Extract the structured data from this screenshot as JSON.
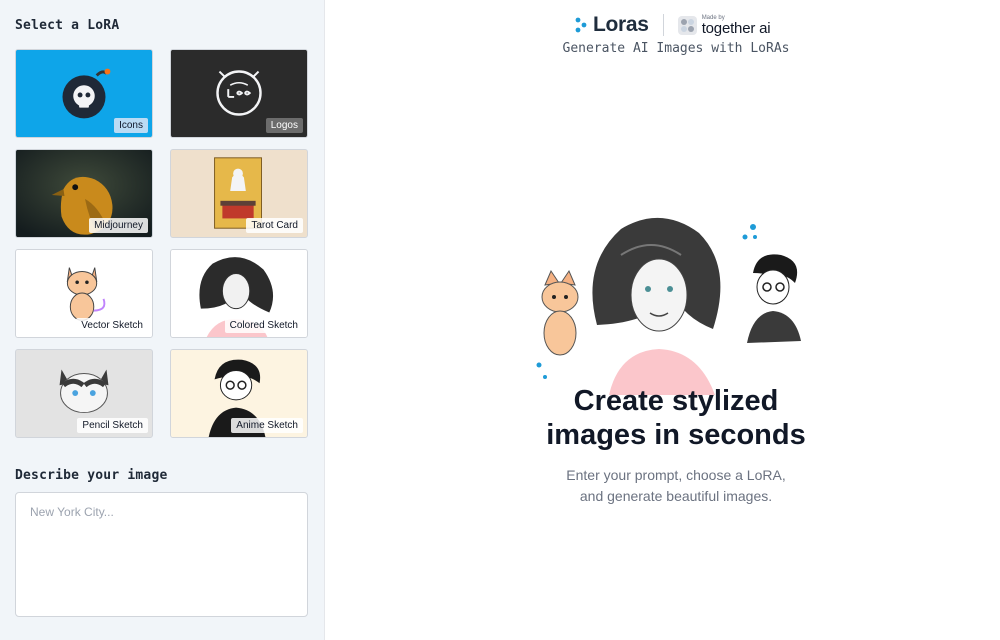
{
  "sidebar": {
    "select_title": "Select a LoRA",
    "loras": [
      {
        "label": "Icons"
      },
      {
        "label": "Logos"
      },
      {
        "label": "Midjourney"
      },
      {
        "label": "Tarot Card"
      },
      {
        "label": "Vector Sketch"
      },
      {
        "label": "Colored Sketch"
      },
      {
        "label": "Pencil Sketch"
      },
      {
        "label": "Anime Sketch"
      }
    ],
    "describe_title": "Describe your image",
    "prompt": {
      "value": "",
      "placeholder": "New York City..."
    }
  },
  "header": {
    "brand_name": "Loras",
    "partner_made_by": "Made by",
    "partner_name": "together ai",
    "tagline": "Generate AI Images with LoRAs"
  },
  "hero": {
    "title_line1": "Create stylized",
    "title_line2": "images in seconds",
    "subtitle_line1": "Enter your prompt, choose a LoRA,",
    "subtitle_line2": "and generate beautiful images."
  },
  "colors": {
    "accent": "#1e9bd7",
    "sidebar_bg": "#f1f5f9",
    "icons_tile_bg": "#0ea5e9",
    "logos_tile_bg": "#2b2b2b"
  }
}
